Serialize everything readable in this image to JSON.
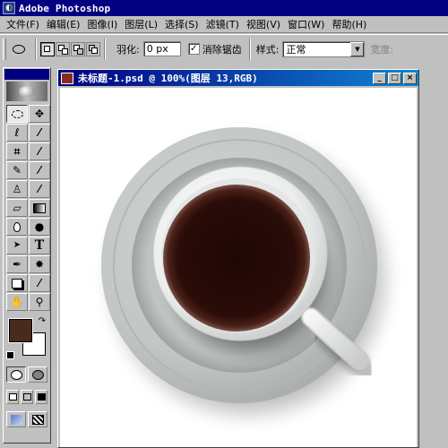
{
  "app": {
    "title": "Adobe Photoshop",
    "icon": "photoshop-app-icon"
  },
  "menu": {
    "items": [
      "文件(F)",
      "编辑(E)",
      "图像(I)",
      "图层(L)",
      "选择(S)",
      "滤镜(T)",
      "视图(V)",
      "窗口(W)",
      "帮助(H)"
    ]
  },
  "options": {
    "tool_preset_icon": "elliptical-marquee-icon",
    "feather_label": "羽化:",
    "feather_value": "0 px",
    "antialias_label": "消除锯齿",
    "antialias_checked": true,
    "antialias_mark": "✓",
    "style_label": "样式:",
    "style_value": "正常",
    "width_label": "宽度:"
  },
  "document": {
    "title": "未标题-1.psd @ 100%(图层 13,RGB)",
    "minimize": "_",
    "maximize": "□",
    "close": "×"
  },
  "colors": {
    "foreground": "#4a2a1c",
    "background": "#ffffff",
    "title_bar": "#000080",
    "coffee": "#2a0c08",
    "saucer": "#c2c6c4"
  },
  "toolbox": {
    "tools": [
      [
        "elliptical-marquee-icon",
        "move-icon"
      ],
      [
        "lasso-icon",
        "magic-wand-icon"
      ],
      [
        "crop-icon",
        "slice-icon"
      ],
      [
        "healing-brush-icon",
        "brush-icon"
      ],
      [
        "clone-stamp-icon",
        "history-brush-icon"
      ],
      [
        "eraser-icon",
        "gradient-icon"
      ],
      [
        "blur-icon",
        "dodge-icon"
      ],
      [
        "path-selection-icon",
        "type-icon"
      ],
      [
        "pen-icon",
        "custom-shape-icon"
      ],
      [
        "notes-icon",
        "eyedropper-icon"
      ],
      [
        "hand-icon",
        "zoom-icon"
      ]
    ],
    "glyphs": {
      "move": "✥",
      "lasso": "ℓ",
      "wand": "⁄",
      "crop": "⌗",
      "slice": "⁄",
      "heal": "✎",
      "brush": "⁄",
      "stamp": "♙",
      "history": "⁄",
      "eraser": "▱",
      "blur": "💧",
      "dodge": "●",
      "path": "➤",
      "type": "T",
      "pen": "✒",
      "shape": "✸",
      "notes": "▭",
      "dropper": "⁄",
      "hand": "✋",
      "zoom": "⚲",
      "swap": "↷"
    }
  }
}
